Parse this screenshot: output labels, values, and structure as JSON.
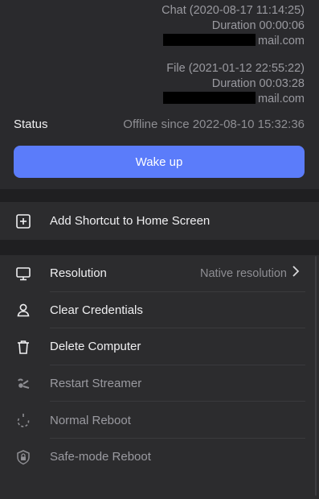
{
  "sessions": [
    {
      "type_line": "Chat (2020-08-17 11:14:25)",
      "duration_line": "Duration 00:00:06",
      "email_suffix": "mail.com"
    },
    {
      "type_line": "File (2021-01-12 22:55:22)",
      "duration_line": "Duration 00:03:28",
      "email_suffix": "mail.com"
    }
  ],
  "status": {
    "label": "Status",
    "value": "Offline since 2022-08-10 15:32:36"
  },
  "wake_button": {
    "label": "Wake up"
  },
  "shortcut": {
    "label": "Add Shortcut to Home Screen",
    "icon": "plus-square-icon"
  },
  "menu": [
    {
      "label": "Resolution",
      "value": "Native resolution",
      "icon": "monitor-icon",
      "enabled": true
    },
    {
      "label": "Clear Credentials",
      "icon": "user-icon",
      "enabled": true
    },
    {
      "label": "Delete Computer",
      "icon": "trash-icon",
      "enabled": true
    },
    {
      "label": "Restart Streamer",
      "icon": "restart-streamer-icon",
      "enabled": false
    },
    {
      "label": "Normal Reboot",
      "icon": "reboot-icon",
      "enabled": false
    },
    {
      "label": "Safe-mode Reboot",
      "icon": "shield-lock-icon",
      "enabled": false
    }
  ],
  "colors": {
    "accent": "#5b7cfa",
    "background": "#2c2c2e",
    "section_gap": "#1f1f21"
  }
}
